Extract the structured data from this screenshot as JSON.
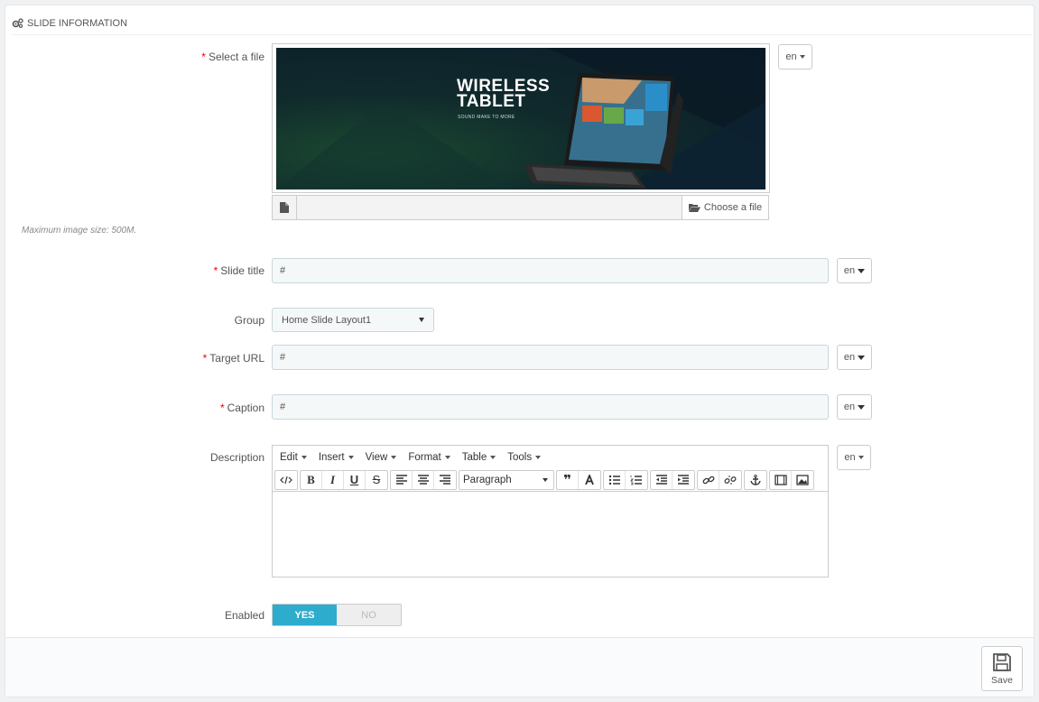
{
  "panel": {
    "title": "SLIDE INFORMATION"
  },
  "fields": {
    "select_file": {
      "label": "Select a file",
      "lang": "en",
      "choose_label": "Choose a file"
    },
    "banner": {
      "title_line1": "WIRELESS",
      "title_line2": "TABLET",
      "subtitle": "SOUND MAKE TO MORE"
    },
    "help_text": "Maximum image size: 500M.",
    "slide_title": {
      "label": "Slide title",
      "value": "#",
      "lang": "en"
    },
    "group": {
      "label": "Group",
      "value": "Home Slide Layout1"
    },
    "target_url": {
      "label": "Target URL",
      "value": "#",
      "lang": "en"
    },
    "caption": {
      "label": "Caption",
      "value": "#",
      "lang": "en"
    },
    "description": {
      "label": "Description",
      "lang": "en"
    },
    "enabled": {
      "label": "Enabled",
      "yes": "YES",
      "no": "NO",
      "value": "YES"
    }
  },
  "editor": {
    "menus": [
      "Edit",
      "Insert",
      "View",
      "Format",
      "Table",
      "Tools"
    ],
    "format_select": "Paragraph",
    "tools": [
      "source-code",
      "bold",
      "italic",
      "underline",
      "strikethrough",
      "align-left",
      "align-center",
      "align-right",
      "blockquote",
      "text-color",
      "bullet-list",
      "numbered-list",
      "outdent",
      "indent",
      "link",
      "unlink",
      "anchor",
      "media",
      "image"
    ],
    "tool_glyphs": {
      "bold": "B",
      "italic": "I",
      "underline": "U",
      "strikethrough": "S"
    }
  },
  "footer": {
    "save_label": "Save"
  },
  "colors": {
    "accent": "#2eacce",
    "required": "#e00000"
  }
}
